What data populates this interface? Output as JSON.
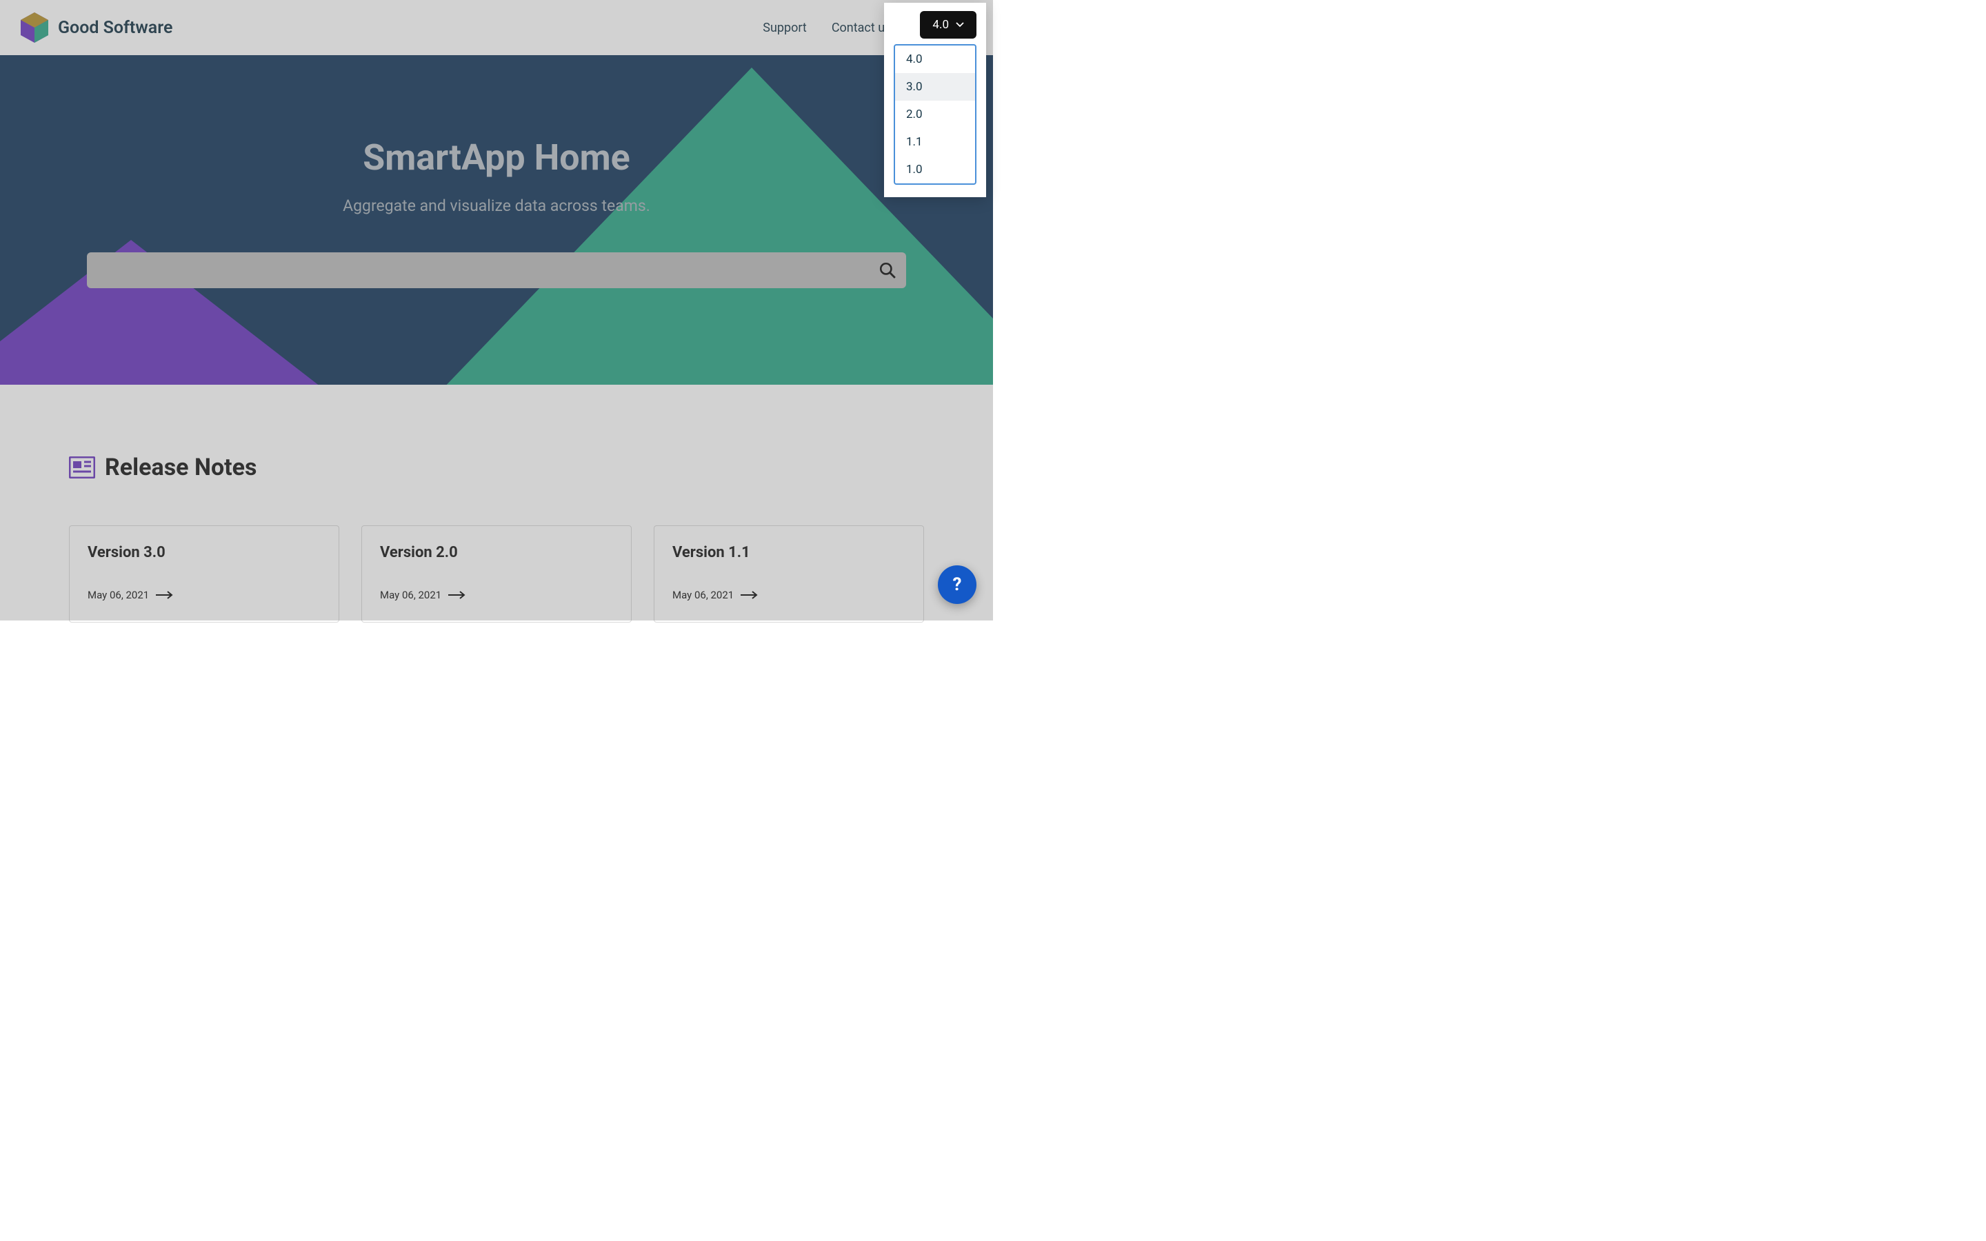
{
  "brand": {
    "name": "Good Software"
  },
  "nav": {
    "support": "Support",
    "contact": "Contact us"
  },
  "version_selector": {
    "selected": "4.0",
    "options": [
      "4.0",
      "3.0",
      "2.0",
      "1.1",
      "1.0"
    ],
    "hover_index": 1
  },
  "hero": {
    "title": "SmartApp Home",
    "subtitle": "Aggregate and visualize data across teams.",
    "search_value": ""
  },
  "release_notes": {
    "heading": "Release Notes",
    "cards": [
      {
        "title": "Version 3.0",
        "date": "May 06, 2021"
      },
      {
        "title": "Version 2.0",
        "date": "May 06, 2021"
      },
      {
        "title": "Version 1.1",
        "date": "May 06, 2021"
      }
    ]
  },
  "help_fab": {
    "label": "?"
  }
}
